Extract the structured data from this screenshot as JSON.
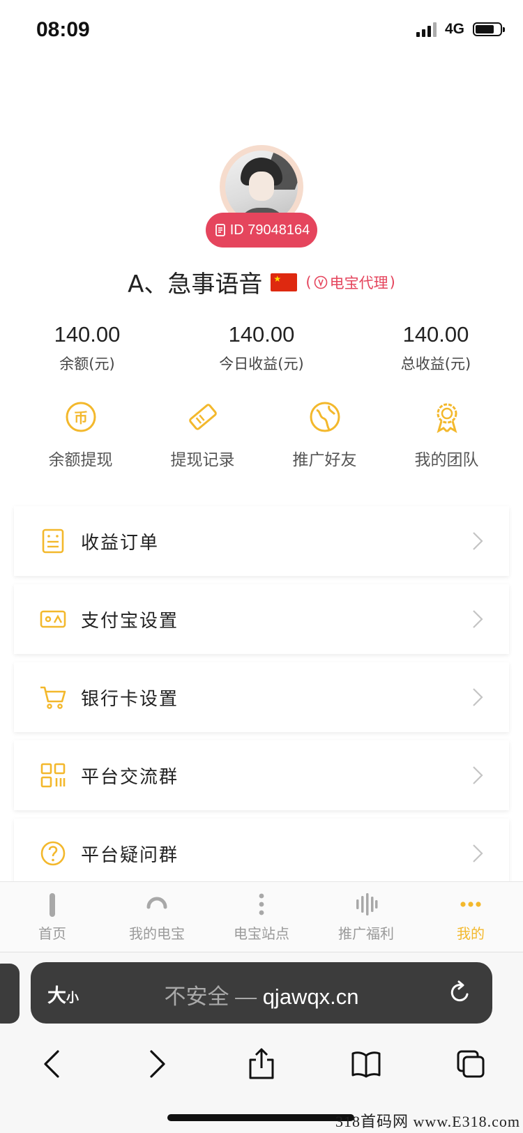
{
  "status_bar": {
    "time": "08:09",
    "network": "4G"
  },
  "profile": {
    "id_label": "ID 79048164",
    "username": "A、急事语音",
    "agent_badge": "电宝代理"
  },
  "stats": [
    {
      "value": "140.00",
      "label": "余额(元)"
    },
    {
      "value": "140.00",
      "label": "今日收益(元)"
    },
    {
      "value": "140.00",
      "label": "总收益(元)"
    }
  ],
  "quick_actions": [
    {
      "label": "余额提现",
      "icon": "coin-icon"
    },
    {
      "label": "提现记录",
      "icon": "ticket-icon"
    },
    {
      "label": "推广好友",
      "icon": "globe-icon"
    },
    {
      "label": "我的团队",
      "icon": "award-icon"
    }
  ],
  "menu": [
    {
      "label": "收益订单",
      "icon": "order-icon"
    },
    {
      "label": "支付宝设置",
      "icon": "wallet-icon"
    },
    {
      "label": "银行卡设置",
      "icon": "cart-icon"
    },
    {
      "label": "平台交流群",
      "icon": "qrcode-icon"
    },
    {
      "label": "平台疑问群",
      "icon": "question-icon"
    }
  ],
  "tabbar": [
    {
      "label": "首页",
      "icon": "bar-icon"
    },
    {
      "label": "我的电宝",
      "icon": "spinner-icon"
    },
    {
      "label": "电宝站点",
      "icon": "dots-vertical-icon"
    },
    {
      "label": "推广福利",
      "icon": "waveform-icon"
    },
    {
      "label": "我的",
      "icon": "dots-horizontal-icon",
      "active": true
    }
  ],
  "colors": {
    "accent": "#f3b82c",
    "badge": "#e5455d"
  },
  "browser": {
    "text_size_big": "大",
    "text_size_small": "小",
    "url_prefix": "不安全 — ",
    "url_domain": "qjawqx.cn"
  },
  "watermark": "318首码网 www.E318.com"
}
